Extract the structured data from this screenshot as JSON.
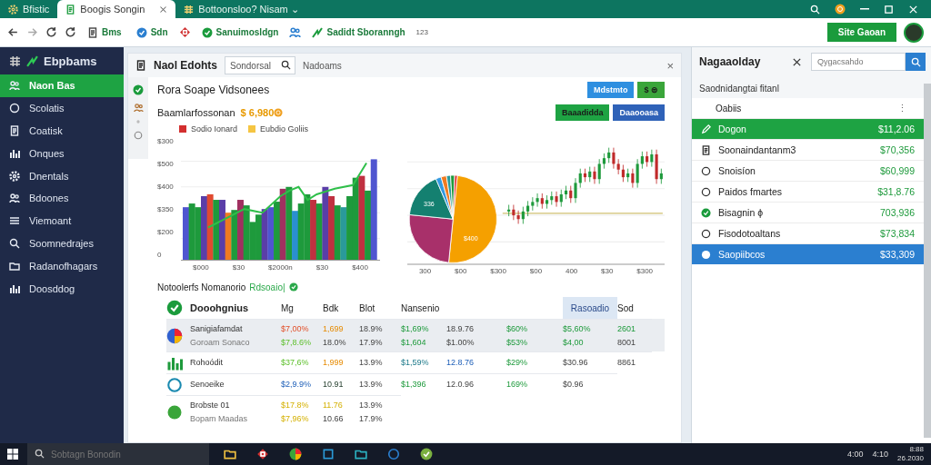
{
  "browser": {
    "tabs": [
      {
        "label": "Bfistic",
        "selected": false
      },
      {
        "label": "Boogis Songin",
        "selected": true
      },
      {
        "label": "Bottoonsloo? Nisam ⌄",
        "selected": false
      }
    ],
    "bookmarks": [
      {
        "label": "Bms"
      },
      {
        "label": "Sdn"
      },
      {
        "label": "Sanuimosldgn"
      },
      {
        "label": "Sadidt Sboranngh"
      }
    ],
    "bookmarks_count": "123",
    "account_button": "Site Gaoan"
  },
  "sidebar": {
    "title": "Ebpbams",
    "items": [
      {
        "label": "Naon Bas",
        "selected": true
      },
      {
        "label": "Scolatis",
        "selected": false
      },
      {
        "label": "Coatisk",
        "selected": false
      },
      {
        "label": "Onques",
        "selected": false
      },
      {
        "label": "Dnentals",
        "selected": false
      },
      {
        "label": "Bdoones",
        "selected": false
      },
      {
        "label": "Viemoant",
        "selected": false
      },
      {
        "label": "Soomnedrajes",
        "selected": false
      },
      {
        "label": "Radanofhagars",
        "selected": false
      },
      {
        "label": "Doosddog",
        "selected": false
      }
    ]
  },
  "panel": {
    "title": "Naol Edohts",
    "search": {
      "value": "Sondorsal"
    },
    "tab_label": "Nadoams",
    "close": "×",
    "heading": "Rora Soape Vidsonees",
    "buttons": [
      {
        "label": "Mdstmto",
        "kind": "blue"
      },
      {
        "label": "$ ⊜",
        "kind": "green"
      }
    ],
    "buttons_2": [
      {
        "label": "Baaadidda",
        "kind": "green"
      },
      {
        "label": "Daaooasa",
        "kind": "blue"
      }
    ],
    "chart_title": "Baamlarfossonan",
    "chart_amount": "$ 6,980",
    "legend": [
      {
        "label": "Sodio Ionard",
        "color": "#d32f2f"
      },
      {
        "label": "Eubdio Goliis",
        "color": "#f5c542"
      }
    ],
    "bar_y_labels": [
      "$300",
      "$500",
      "$400",
      "$350",
      "$200",
      "0"
    ],
    "bar_x_labels": [
      "$000",
      "$30",
      "$2000n",
      "$30",
      "$400"
    ],
    "pie_labels": [
      "336",
      "$400"
    ],
    "right_x_labels": [
      "300",
      "$00",
      "$300",
      "$00",
      "400",
      "$30",
      "$300"
    ],
    "table_title": "Notoolerfs Nomanorio",
    "table_badge": "Rdsoaio|",
    "table": {
      "name_header": "Dooohgnius",
      "columns": [
        {
          "label": "Mg",
          "highlighted": false
        },
        {
          "label": "Bdk",
          "highlighted": false
        },
        {
          "label": "Blot",
          "highlighted": false
        },
        {
          "label": "Nansenio",
          "highlighted": false
        },
        null,
        null,
        {
          "label": "Rasoadio",
          "highlighted": true
        },
        {
          "label": "Sod",
          "highlighted": false
        }
      ],
      "rows": [
        {
          "name": "Sanigiafamdat",
          "sub": "Goroam Sonaco",
          "selected": true,
          "cells": [
            {
              "text": "$7,00%",
              "kind": "red"
            },
            {
              "text": "1,699",
              "kind": "orange"
            },
            {
              "text": "18.9%",
              "kind": "plain"
            },
            {
              "text": "$1,69%",
              "kind": "green"
            },
            {
              "text": "18.9.76",
              "kind": "plain"
            },
            {
              "text": "$60%",
              "kind": "green"
            },
            {
              "text": "$5,60%",
              "kind": "green"
            },
            {
              "text": "2601",
              "kind": "green"
            }
          ],
          "cells_2": [
            {
              "text": "$7,8.6%",
              "kind": "lime"
            },
            {
              "text": "18.0%",
              "kind": "plain"
            },
            {
              "text": "17.9%",
              "kind": "plain"
            },
            {
              "text": "$1,604",
              "kind": "green"
            },
            {
              "text": "$1.00%",
              "kind": "plain"
            },
            {
              "text": "$53%",
              "kind": "green"
            },
            {
              "text": "$4,00",
              "kind": "green"
            },
            {
              "text": "8001",
              "kind": "plain"
            }
          ]
        },
        {
          "name": "Rohoódit",
          "selected": false,
          "cells": [
            {
              "text": "$37,6%",
              "kind": "lime"
            },
            {
              "text": "1,999",
              "kind": "orange"
            },
            {
              "text": "13.9%",
              "kind": "plain"
            },
            {
              "text": "$1,59%",
              "kind": "teal"
            },
            {
              "text": "12.8.76",
              "kind": "blue"
            },
            {
              "text": "$29%",
              "kind": "green"
            },
            {
              "text": "$30.96",
              "kind": "plain"
            },
            {
              "text": "8861",
              "kind": "plain"
            }
          ]
        },
        {
          "name": "Senoeike",
          "selected": false,
          "cells": [
            {
              "text": "$2,9.9%",
              "kind": "blue"
            },
            {
              "text": "10.91",
              "kind": "dark"
            },
            {
              "text": "13.9%",
              "kind": "plain"
            },
            {
              "text": "$1,396",
              "kind": "green"
            },
            {
              "text": "12.0.96",
              "kind": "plain"
            },
            {
              "text": "169%",
              "kind": "green"
            },
            {
              "text": "$0.96",
              "kind": "plain"
            }
          ]
        },
        {
          "name": "Brobste 01",
          "sub": "Bopam Maadas",
          "selected": false,
          "cells": [
            {
              "text": "$17.8%",
              "kind": "yellow"
            },
            {
              "text": "11.76",
              "kind": "yellow"
            },
            {
              "text": "13.9%",
              "kind": "plain"
            }
          ],
          "cells_2": [
            {
              "text": "$7,96%",
              "kind": "yellow"
            },
            {
              "text": "10.66",
              "kind": "plain"
            },
            {
              "text": "17.9%",
              "kind": "plain"
            }
          ]
        }
      ]
    }
  },
  "watchlist": {
    "title": "Nagaaolday",
    "search": {
      "placeholder": "Qygacsahdo"
    },
    "section": "Saodnidangtai fitanl",
    "group": "Oabiis",
    "menu": "⋮",
    "items": [
      {
        "name": "Dogon",
        "value": "$11,2.06",
        "kind": "green"
      },
      {
        "name": "Soonaindantanm3",
        "value": "$70,356",
        "kind": "plain"
      },
      {
        "name": "Snoisíon",
        "value": "$60,999",
        "kind": "plain"
      },
      {
        "name": "Paidos fmartes",
        "value": "$31,8.76",
        "kind": "plain"
      },
      {
        "name": "Bisagnin ϕ",
        "value": "703,936",
        "kind": "plain"
      },
      {
        "name": "Fisodotoaltans",
        "value": "$73,834",
        "kind": "plain"
      },
      {
        "name": "Saopiibcos",
        "value": "$33,309",
        "kind": "blue"
      }
    ]
  },
  "taskbar": {
    "search": {
      "placeholder": "Sobtagn Bonodin"
    },
    "tray": [
      "4:00",
      "4:10"
    ],
    "clock": {
      "time": "8:88",
      "date": "26.2030"
    }
  }
}
